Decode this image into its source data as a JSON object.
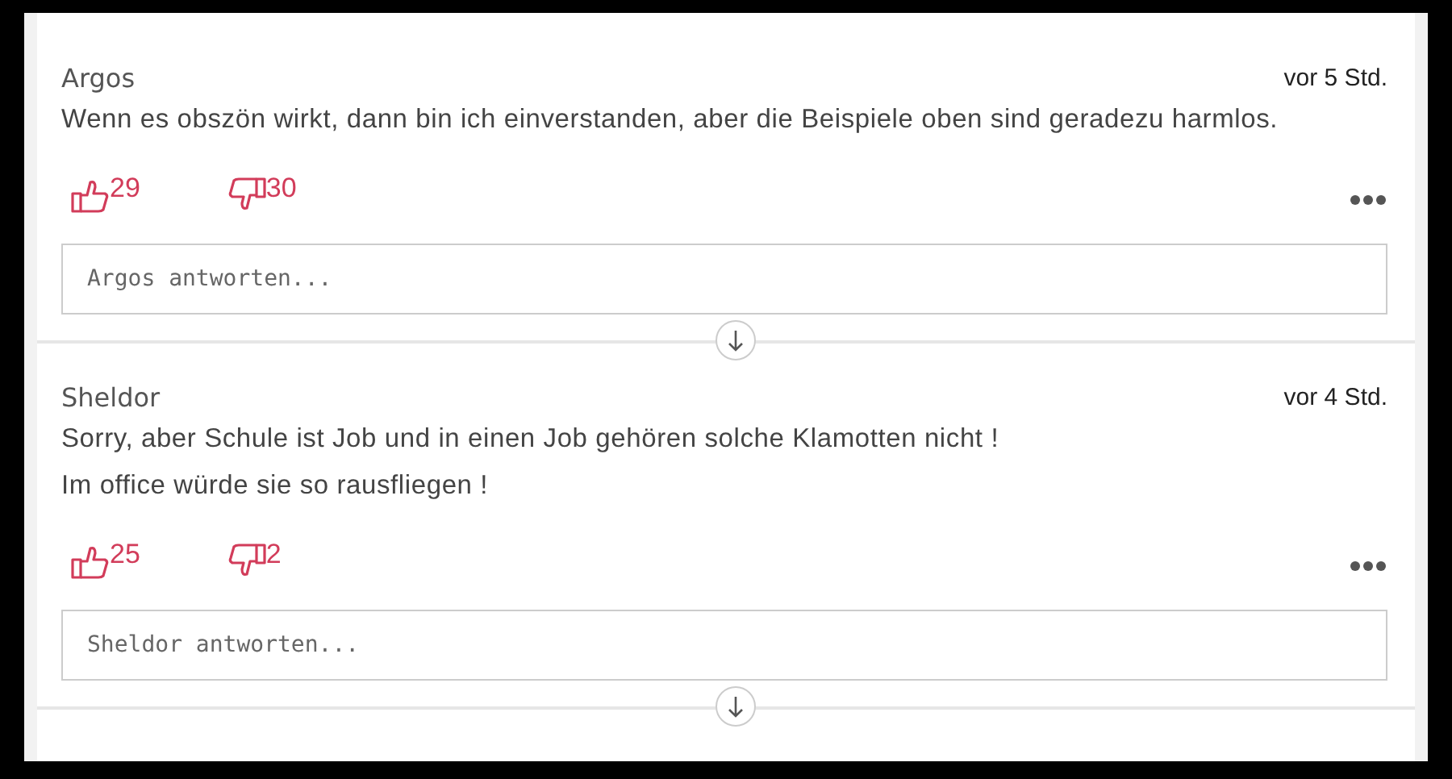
{
  "comments": [
    {
      "author": "Argos",
      "time": "vor 5 Std.",
      "text": [
        "Wenn es obszön wirkt, dann bin ich einverstanden, aber die Beispiele oben sind geradezu harmlos."
      ],
      "likes": "29",
      "dislikes": "30",
      "reply": {
        "placeholder": "Argos antworten..."
      }
    },
    {
      "author": "Sheldor",
      "time": "vor 4 Std.",
      "text": [
        "Sorry, aber Schule ist Job und in einen Job gehören solche Klamotten nicht !",
        "Im office würde sie so rausfliegen !"
      ],
      "likes": "25",
      "dislikes": "2",
      "reply": {
        "placeholder": "Sheldor antworten..."
      }
    }
  ]
}
